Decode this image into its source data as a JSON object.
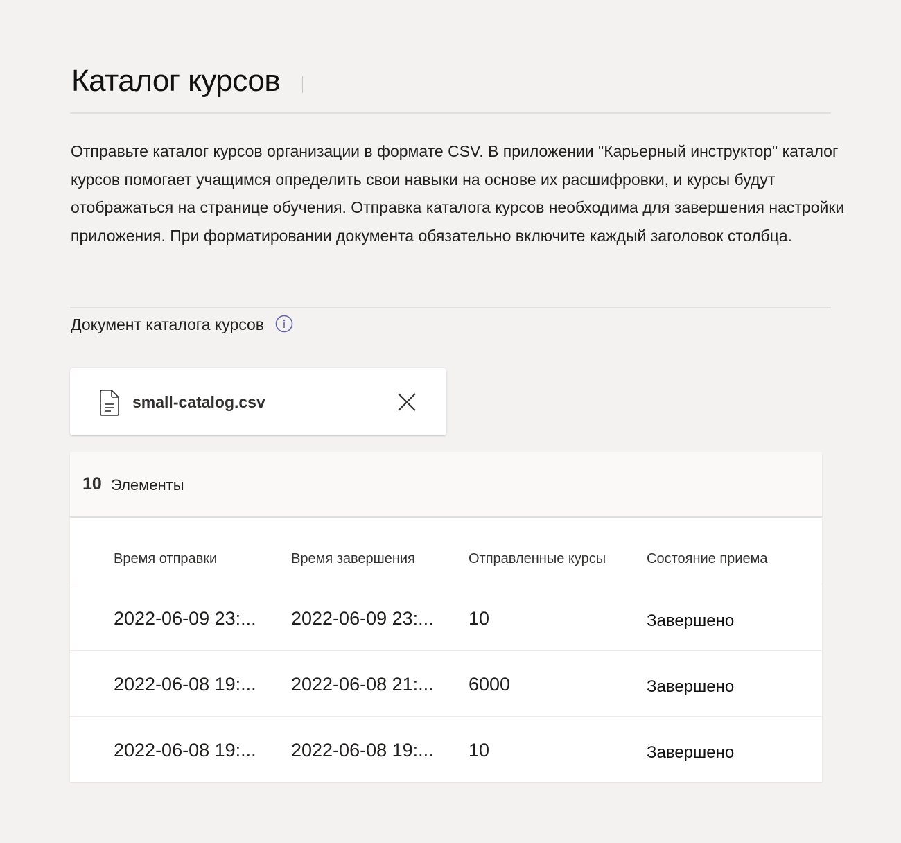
{
  "page": {
    "title": "Каталог курсов",
    "description": "Отправьте каталог курсов организации в формате CSV. В приложении \"Карьерный инструктор\" каталог курсов помогает учащимся определить свои навыки на основе их расшифровки, и курсы будут отображаться на странице обучения. Отправка каталога курсов необходима для завершения настройки приложения. При форматировании документа обязательно включите каждый заголовок столбца."
  },
  "document_section": {
    "label": "Документ каталога курсов",
    "info_icon": "info-circle-icon",
    "accent_color": "#6264a7"
  },
  "file": {
    "name": "small-catalog.csv",
    "icon": "document-icon",
    "remove_icon": "close-icon"
  },
  "table": {
    "count": "10",
    "count_label": "Элементы",
    "columns": [
      "Время отправки",
      "Время завершения",
      "Отправленные курсы",
      "Состояние приема"
    ],
    "rows": [
      [
        "2022-06-09 23:...",
        "2022-06-09 23:...",
        "10",
        "Завершено"
      ],
      [
        "2022-06-08 19:...",
        "2022-06-08 21:...",
        "6000",
        "Завершено"
      ],
      [
        "2022-06-08 19:...",
        "2022-06-08 19:...",
        "10",
        "Завершено"
      ]
    ]
  }
}
